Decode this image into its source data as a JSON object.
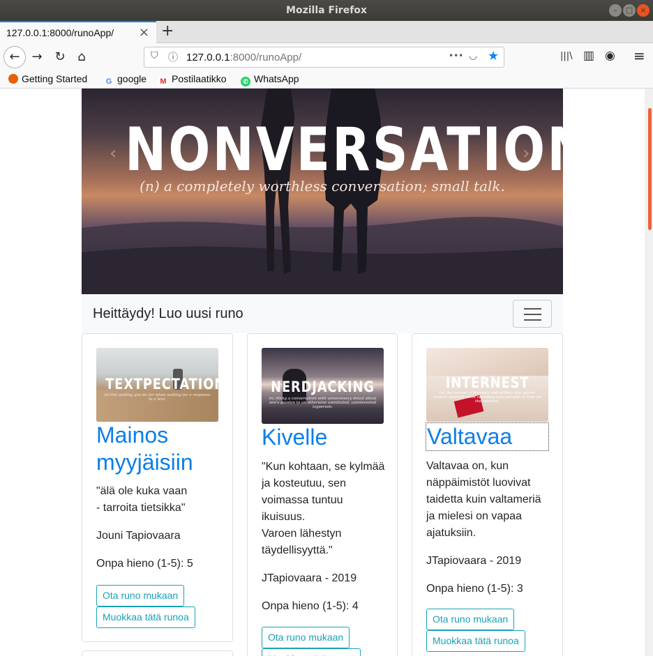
{
  "window": {
    "title": "Mozilla Firefox",
    "minimize_glyph": "–",
    "maximize_glyph": "□",
    "close_glyph": "×"
  },
  "tab": {
    "label": "127.0.0.1:8000/runoApp/",
    "close_glyph": "×",
    "new_tab_glyph": "+"
  },
  "nav": {
    "back_icon": "←",
    "forward_icon": "→",
    "reload_icon": "↻",
    "home_icon": "⌂",
    "url_host": "127.0.0.1",
    "url_rest": ":8000/runoApp/",
    "more_icon": "•••",
    "pocket_icon": "◡",
    "star_icon": "★",
    "library_icon": "|||\\",
    "sidebar_icon": "▥",
    "account_icon": "◉",
    "menu_icon": "≡"
  },
  "bookmarks": [
    {
      "label": "Getting Started",
      "icon": "firefox-icon",
      "color": "#e66000",
      "glyph": ""
    },
    {
      "label": "google",
      "icon": "google-icon",
      "color": "#4285f4",
      "glyph": "G"
    },
    {
      "label": "Postilaatikko",
      "icon": "gmail-icon",
      "color": "#d93025",
      "glyph": "M"
    },
    {
      "label": "WhatsApp",
      "icon": "whatsapp-icon",
      "color": "#25d366",
      "glyph": "✆"
    }
  ],
  "hero": {
    "word": "NONVERSATION",
    "definition": "(n) a completely worthless conversation; small talk."
  },
  "appbar": {
    "brand": "Heittäydy! Luo uusi runo"
  },
  "cards": [
    {
      "thumb_word": "TEXTPECTATION",
      "thumb_sub": "(n) the waiting you do for when waiting for a response to a text.",
      "title": "Mainos myyjäisiin",
      "poem": "\"älä ole kuka vaan\n- tarroita tietsikka\"",
      "author": "Jouni Tapiovaara",
      "rating": "Onpa hieno (1-5): 5",
      "btn_take": "Ota runo mukaan",
      "btn_edit": "Muokkaa tätä runoa"
    },
    {
      "thumb_word": "NERDJACKING",
      "thumb_sub": "(n) filling a conversation with unnecessary detail about one's passion to an otherwise uninitiated, uninterested layperson.",
      "title": "Kivelle",
      "poem": "\"Kun kohtaan, se kylmää ja kosteutuu, sen voimassa tuntuu ikuisuus.\nVaroen lähestyn täydellisyyttä.\"",
      "author": "JTapiovaara - 2019",
      "rating": "Onpa hieno (1-5): 4",
      "btn_take": "Ota runo mukaan",
      "btn_edit": "Muokkaa tätä runoa"
    },
    {
      "thumb_word": "INTERNEST",
      "thumb_sub": "(n) the cocoon of blankets and pillows you gather around yourself while spending long periods of time on the internet.",
      "title": "Valtavaa",
      "poem": "Valtavaa on, kun näppäimistöt luovivat taidetta kuin valtameriä ja mielesi on vapaa ajatuksiin.",
      "author": "JTapiovaara - 2019",
      "rating": "Onpa hieno (1-5): 3",
      "btn_take": "Ota runo mukaan",
      "btn_edit": "Muokkaa tätä runoa"
    }
  ]
}
